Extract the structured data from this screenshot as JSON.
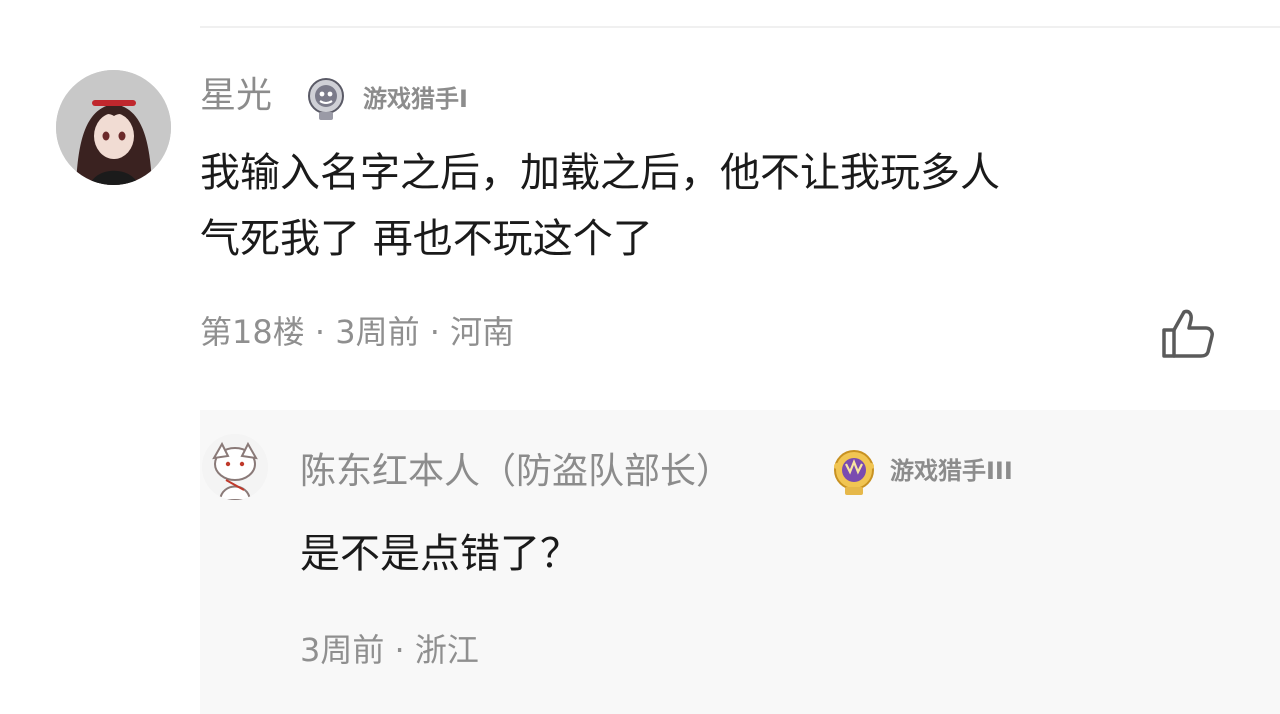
{
  "comment": {
    "author": "星光",
    "badge_icon": "game-hunter-badge-icon",
    "title": "游戏猎手I",
    "text_line1": "我输入名字之后，加载之后，他不让我玩多人",
    "text_line2": "气死我了 再也不玩这个了",
    "meta": "第18楼 · 3周前 · 河南",
    "like_icon": "thumbs-up-icon"
  },
  "reply": {
    "author": "陈东红本人（防盗队部长）",
    "badge_icon": "game-hunter-gold-badge-icon",
    "title": "游戏猎手III",
    "text": "是不是点错了？",
    "meta": "3周前 · 浙江"
  },
  "colors": {
    "text_primary": "#1a1a1a",
    "text_secondary": "#8c8c8c",
    "reply_background": "#f8f8f8",
    "badge_gold": "#e6b84a",
    "badge_purple": "#7a4bb0"
  }
}
